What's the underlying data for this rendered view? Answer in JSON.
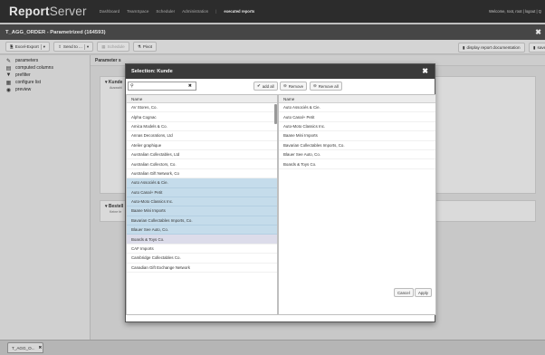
{
  "app": {
    "brand_bold": "Report",
    "brand_light": "Server",
    "nav": [
      "Dashboard",
      "TeamSpace",
      "Scheduler",
      "Administration",
      "|",
      "executed reports"
    ],
    "welcome": "Welcome, root, root | logout | Q"
  },
  "report_title": "T_AGG_ORDER - Parametrized (164593)",
  "toolbar": {
    "export": "Excel-Export",
    "send": "Send to ...",
    "schedule": "Schedule",
    "pivot": "Pivot",
    "display_doc": "display report documentation",
    "save": "save"
  },
  "sidebar": [
    {
      "icon": "pencil-icon",
      "label": "parameters"
    },
    {
      "icon": "table-icon",
      "label": "computed columns"
    },
    {
      "icon": "filter-icon",
      "label": "prefilter"
    },
    {
      "icon": "grid-icon",
      "label": "configure list"
    },
    {
      "icon": "eye-icon",
      "label": "preview"
    }
  ],
  "main": {
    "param_head": "Parameter s",
    "box1_title": "Kunde",
    "box1_sub": "Auswahl",
    "box2_title": "Bestell",
    "box2_sub": "Keine fe"
  },
  "modal": {
    "title": "Selection: Kunde",
    "search_value": "",
    "add_all": "add all",
    "remove": "Remove",
    "remove_all": "Remove all",
    "left_header": "Name",
    "right_header": "Name",
    "left_items": [
      "AV Stores, Co.",
      "Alpha Cognac",
      "Amica Models & Co.",
      "Annas Decorations, Ltd",
      "Atelier graphique",
      "Australian Collectables, Ltd",
      "Australian Collectors, Co.",
      "Australian Gift Network, Co",
      "Auto Associés & Cie.",
      "Auto Canal+ Petit",
      "Auto-Moto Classics Inc.",
      "Baane Mini Imports",
      "Bavarian Collectables Imports, Co.",
      "Blauer See Auto, Co.",
      "Boards & Toys Co.",
      "CAF Imports",
      "Cambridge Collectables Co.",
      "Canadian Gift Exchange Network"
    ],
    "right_items": [
      "Auto Associés & Cie.",
      "Auto Canal+ Petit",
      "Auto-Moto Classics Inc.",
      "Baane Mini Imports",
      "Bavarian Collectables Imports, Co.",
      "Blauer See Auto, Co.",
      "Boards & Toys Co."
    ],
    "cancel": "Cancel",
    "apply": "Apply"
  },
  "bottom_tab": "T_AGG_O...",
  "colors": {
    "topbar": "#2d2d2d",
    "selection": "#c5dceb",
    "modal_header": "#3a3a3a"
  }
}
